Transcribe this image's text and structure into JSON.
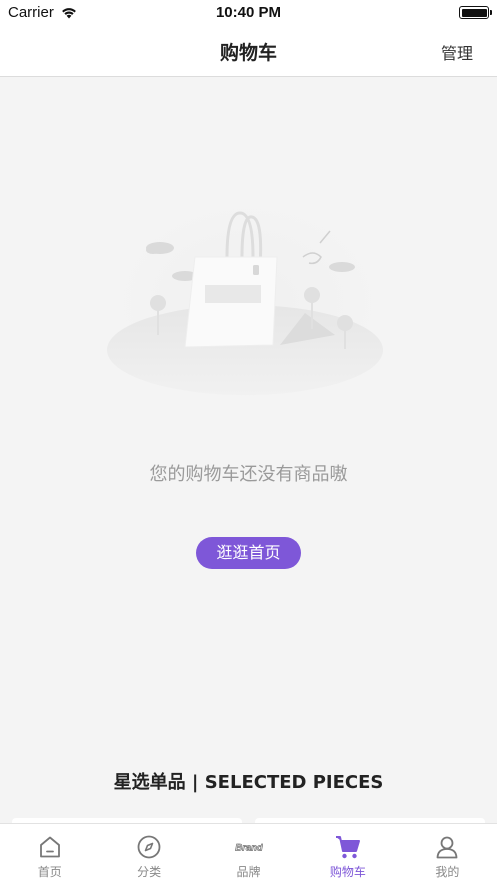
{
  "status_bar": {
    "carrier": "Carrier",
    "time": "10:40 PM"
  },
  "nav": {
    "title": "购物车",
    "manage_label": "管理"
  },
  "empty_state": {
    "message": "您的购物车还没有商品嗷",
    "button_label": "逛逛首页"
  },
  "section": {
    "title": "星选单品 | SELECTED PIECES"
  },
  "tabs": [
    {
      "label": "首页",
      "icon": "home-icon"
    },
    {
      "label": "分类",
      "icon": "compass-icon"
    },
    {
      "label": "品牌",
      "icon": "brand-icon",
      "icon_text": "Brand"
    },
    {
      "label": "购物车",
      "icon": "cart-icon",
      "active": true
    },
    {
      "label": "我的",
      "icon": "profile-icon"
    }
  ],
  "colors": {
    "accent": "#7e57d8",
    "background": "#f4f4f4",
    "muted_text": "#9a9a9a"
  }
}
